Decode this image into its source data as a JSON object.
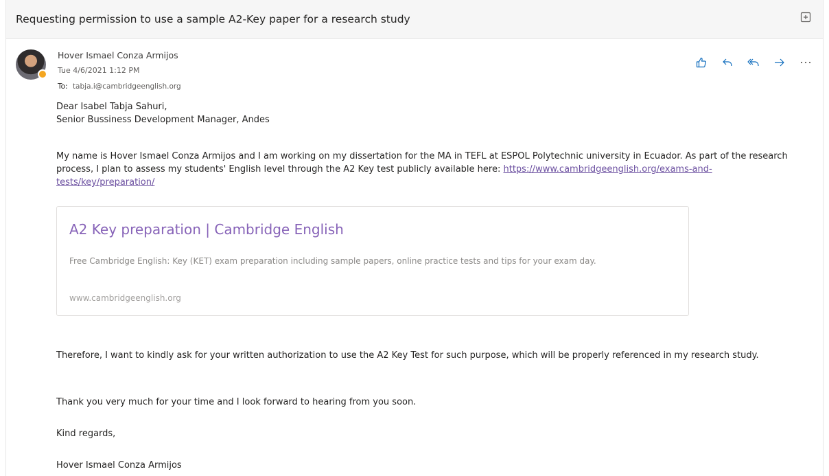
{
  "subject": "Requesting permission to use a sample A2-Key paper for a research study",
  "icons": {
    "expand": "open-in-new-window-icon",
    "like": "thumbs-up-icon",
    "reply": "reply-icon",
    "reply_all": "reply-all-icon",
    "forward": "forward-icon",
    "more": "more-actions-icon"
  },
  "sender": {
    "name": "Hover Ismael Conza Armijos",
    "date": "Tue 4/6/2021 1:12 PM",
    "to_label": "To:",
    "to_address": "tabja.i@cambridgeenglish.org"
  },
  "body": {
    "greeting_line1": "Dear Isabel Tabja Sahuri,",
    "greeting_line2": "Senior Bussiness Development Manager, Andes",
    "para1_text": "My name is Hover Ismael Conza Armijos and I am working on my dissertation for the MA in TEFL at ESPOL Polytechnic university in Ecuador. As part of the research process, I plan to assess my students' English level through the A2 Key test publicly available here: ",
    "para1_link": "https://www.cambridgeenglish.org/exams-and-tests/key/preparation/",
    "card": {
      "title": "A2 Key preparation | Cambridge English",
      "description": "Free Cambridge English: Key (KET) exam preparation including sample papers, online practice tests and tips for your exam day.",
      "url": "www.cambridgeenglish.org"
    },
    "para2": "Therefore, I want to kindly ask for your written authorization to use the A2 Key Test for such purpose, which will be properly referenced in my research study.",
    "para3": "Thank you very much for your time and I look forward to hearing from you soon.",
    "para4": "Kind regards,",
    "signature": "Hover Ismael Conza Armijos"
  },
  "colors": {
    "accent": "#0f6cbd",
    "link": "#6b4fa0",
    "card_title": "#8763b8"
  }
}
